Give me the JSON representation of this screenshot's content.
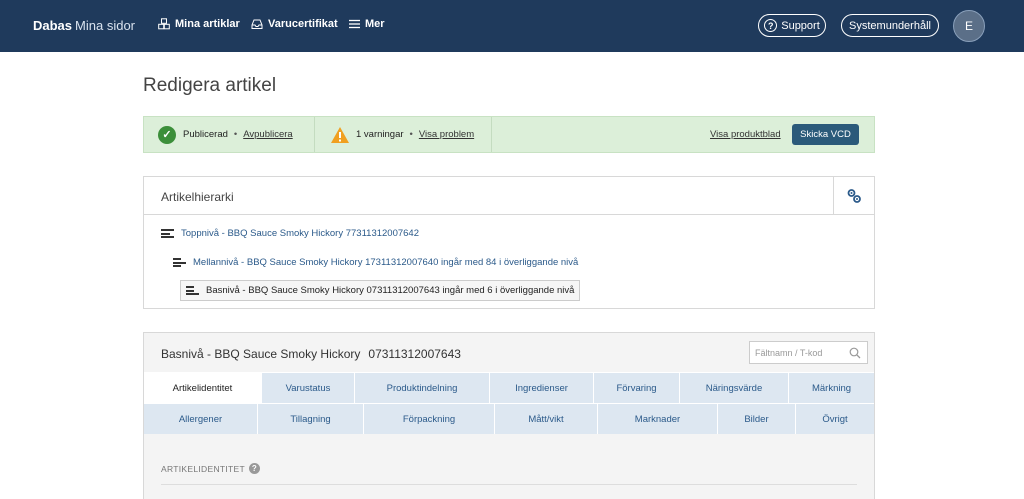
{
  "navbar": {
    "brand_bold": "Dabas",
    "brand_light": "Mina sidor",
    "items": [
      {
        "label": "Mina artiklar",
        "icon": "cubes-icon"
      },
      {
        "label": "Varucertifikat",
        "icon": "inbox-icon"
      },
      {
        "label": "Mer",
        "icon": "hamburger-icon"
      }
    ],
    "support_label": "Support",
    "maintenance_label": "Systemunderhåll",
    "avatar_initial": "E"
  },
  "page": {
    "title": "Redigera artikel"
  },
  "status": {
    "published_label": "Publicerad",
    "unpublish_link": "Avpublicera",
    "warnings_label": "1 varningar",
    "show_problem_link": "Visa problem",
    "product_sheet_link": "Visa produktblad",
    "send_button": "Skicka VCD",
    "colors": {
      "bg": "#dcefd9",
      "check": "#3c8f3a",
      "warn": "#f0a020",
      "button": "#2b5a7a"
    }
  },
  "hierarchy": {
    "title": "Artikelhierarki",
    "top": "Toppnivå - BBQ Sauce Smoky Hickory 77311312007642",
    "middle": "Mellannivå - BBQ Sauce Smoky Hickory 17311312007640 ingår med 84 i överliggande nivå",
    "base": "Basnivå - BBQ Sauce Smoky Hickory 07311312007643 ingår med 6 i överliggande nivå"
  },
  "article": {
    "title": "Basnivå - BBQ Sauce Smoky Hickory",
    "gtin": "07311312007643",
    "search_placeholder": "Fältnamn / T-kod",
    "tabs_row1": [
      "Artikelidentitet",
      "Varustatus",
      "Produktindelning",
      "Ingredienser",
      "Förvaring",
      "Näringsvärde",
      "Märkning"
    ],
    "tabs_row2": [
      "Allergener",
      "Tillagning",
      "Förpackning",
      "Mått/vikt",
      "Marknader",
      "Bilder",
      "Övrigt"
    ],
    "active_tab": "Artikelidentitet",
    "section_label": "ARTIKELIDENTITET"
  }
}
